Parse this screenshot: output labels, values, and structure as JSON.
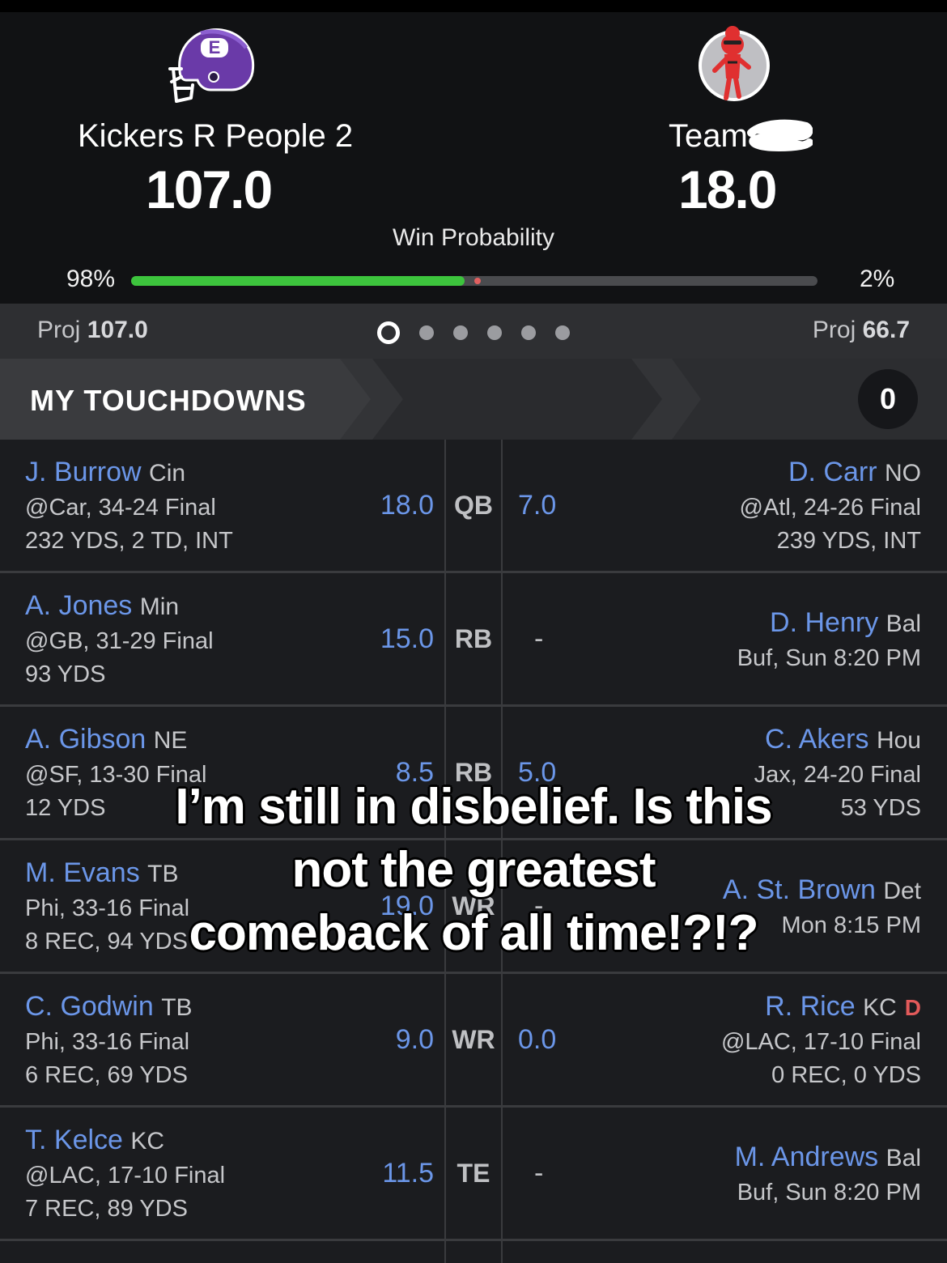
{
  "home": {
    "name": "Kickers R People 2",
    "score": "107.0",
    "win_pct": "98%",
    "win_fraction": 0.98,
    "proj_label": "Proj",
    "proj_value": "107.0",
    "logo_icon": "purple-football-helmet-icon",
    "logo_letter": "E"
  },
  "away": {
    "name": "Team",
    "score": "18.0",
    "win_pct": "2%",
    "proj_label": "Proj",
    "proj_value": "66.7",
    "logo_icon": "red-character-avatar-icon"
  },
  "win_probability_label": "Win Probability",
  "pager": {
    "count": 6,
    "active": 0
  },
  "banner": {
    "title": "MY TOUCHDOWNS",
    "count": "0"
  },
  "rows": [
    {
      "left": {
        "name": "J. Burrow",
        "team": "Cin",
        "line1": "@Car, 34-24 Final",
        "line2": "232 YDS, 2 TD, INT",
        "score": "18.0"
      },
      "pos": "QB",
      "right": {
        "name": "D. Carr",
        "team": "NO",
        "line1": "@Atl, 24-26 Final",
        "line2": "239 YDS, INT",
        "score": "7.0",
        "flag": ""
      }
    },
    {
      "left": {
        "name": "A. Jones",
        "team": "Min",
        "line1": "@GB, 31-29 Final",
        "line2": "93 YDS",
        "score": "15.0"
      },
      "pos": "RB",
      "right": {
        "name": "D. Henry",
        "team": "Bal",
        "line1": "Buf, Sun 8:20 PM",
        "line2": "",
        "score": "-",
        "flag": ""
      }
    },
    {
      "left": {
        "name": "A. Gibson",
        "team": "NE",
        "line1": "@SF, 13-30 Final",
        "line2": "12 YDS",
        "score": "8.5"
      },
      "pos": "RB",
      "right": {
        "name": "C. Akers",
        "team": "Hou",
        "line1": "Jax, 24-20 Final",
        "line2": "53 YDS",
        "score": "5.0",
        "flag": ""
      }
    },
    {
      "left": {
        "name": "M. Evans",
        "team": "TB",
        "line1": "Phi, 33-16 Final",
        "line2": "8 REC, 94 YDS",
        "score": "19.0"
      },
      "pos": "WR",
      "right": {
        "name": "A. St. Brown",
        "team": "Det",
        "line1": "Mon 8:15 PM",
        "line2": "",
        "score": "-",
        "flag": ""
      }
    },
    {
      "left": {
        "name": "C. Godwin",
        "team": "TB",
        "line1": "Phi, 33-16 Final",
        "line2": "6 REC, 69 YDS",
        "score": "9.0"
      },
      "pos": "WR",
      "right": {
        "name": "R. Rice",
        "team": "KC",
        "line1": "@LAC, 17-10 Final",
        "line2": "0 REC, 0 YDS",
        "score": "0.0",
        "flag": "D"
      }
    },
    {
      "left": {
        "name": "T. Kelce",
        "team": "KC",
        "line1": "@LAC, 17-10 Final",
        "line2": "7 REC, 89 YDS",
        "score": "11.5"
      },
      "pos": "TE",
      "right": {
        "name": "M. Andrews",
        "team": "Bal",
        "line1": "Buf, Sun 8:20 PM",
        "line2": "",
        "score": "-",
        "flag": ""
      }
    }
  ],
  "caption": {
    "lines": [
      "I’m still in disbelief. Is this",
      "not the greatest",
      "comeback of all time!?!?"
    ]
  },
  "colors": {
    "accent_blue": "#6b96e8",
    "win_green": "#3dc43d",
    "loss_red": "#e26060",
    "helmet_purple": "#6a3aa8"
  }
}
